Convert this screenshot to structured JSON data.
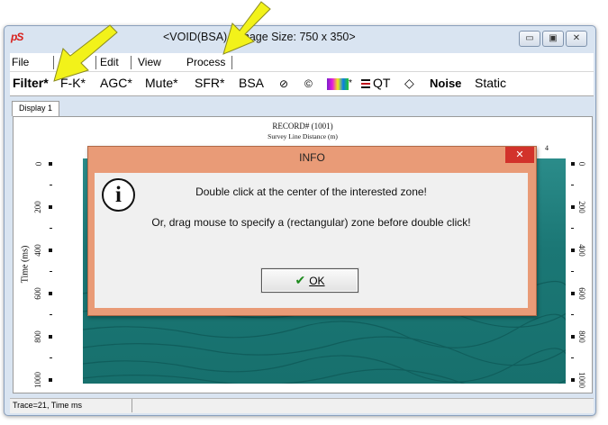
{
  "window": {
    "app_logo": "pS",
    "title": "<VOID(BSA) <Image Size: 750 x 350>",
    "min_glyph": "▭",
    "max_glyph": "▣",
    "close_glyph": "✕"
  },
  "menu": {
    "file": "File",
    "edit": "Edit",
    "view": "View",
    "process": "Process"
  },
  "toolbar": {
    "filter": "Filter*",
    "fk": "F-K*",
    "agc": "AGC*",
    "mute": "Mute*",
    "sfr": "SFR*",
    "bsa": "BSA",
    "gear1_glyph": "⊘",
    "gear2_glyph": "©",
    "color_suffix": "*",
    "qt": "QT",
    "diamond_glyph": "◇",
    "noise": "Noise",
    "static": "Static"
  },
  "tabs": {
    "display1": "Display 1"
  },
  "plot": {
    "record_title": "RECORD# (1001)",
    "x_title": "Survey Line Distance (m)",
    "y_title": "Time (ms)",
    "y_ticks": [
      "0",
      "200",
      "400",
      "600",
      "800",
      "1000"
    ],
    "top_right_tick": "4"
  },
  "dialog": {
    "title": "INFO",
    "close_glyph": "✕",
    "icon_glyph": "i",
    "message_line1": "Double click at the center of the interested zone!",
    "message_line2": "Or, drag mouse to specify a (rectangular) zone before double click!",
    "ok_check": "✔",
    "ok_label": "OK"
  },
  "status": {
    "trace_time": "Trace=21, Time ms"
  },
  "colors": {
    "dialog_frame": "#e99b77",
    "dialog_close": "#d2322b",
    "seismic": "#1b7775",
    "annotation_arrow": "#f2f21a"
  }
}
